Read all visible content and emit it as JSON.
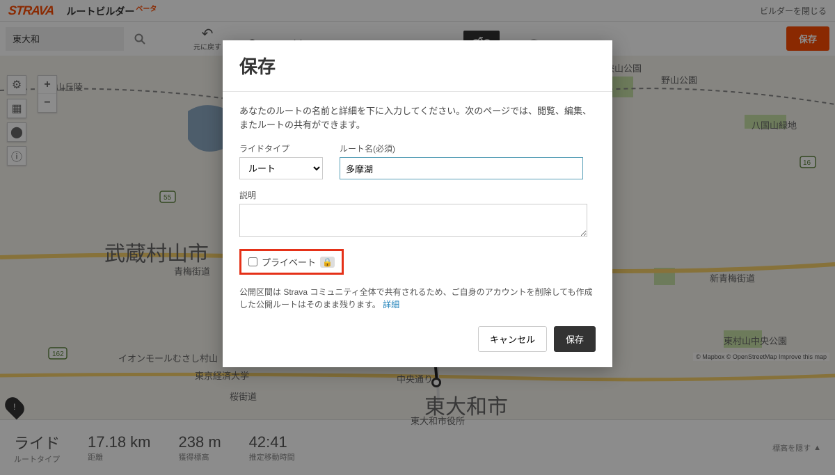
{
  "header": {
    "logo": "STRAVA",
    "title": "ルートビルダー",
    "beta": "ベータ",
    "close": "ビルダーを閉じる"
  },
  "toolbar": {
    "search_value": "東大和",
    "undo": "元に戻す",
    "save_label": "保存"
  },
  "modal": {
    "title": "保存",
    "description": "あなたのルートの名前と詳細を下に入力してください。次のページでは、閲覧、編集、またルートの共有ができます。",
    "ride_type_label": "ライドタイプ",
    "ride_type_value": "ルート",
    "route_name_label": "ルート名(必須)",
    "route_name_value": "多摩湖",
    "desc_label": "説明",
    "desc_value": "",
    "private_label": "プライベート",
    "note_text": "公開区間は Strava コミュニティ全体で共有されるため、ご自身のアカウントを削除しても作成した公開ルートはそのまま残ります。",
    "note_link": "詳細",
    "cancel": "キャンセル",
    "save": "保存"
  },
  "stats": {
    "s1_v": "ライド",
    "s1_l": "ルートタイプ",
    "s2_v": "17.18 km",
    "s2_l": "距離",
    "s3_v": "238 m",
    "s3_l": "獲得標高",
    "s4_v": "42:41",
    "s4_l": "推定移動時間",
    "elev_toggle": "標高を隠す"
  },
  "map": {
    "label1": "武蔵村山市",
    "label2": "東大和市",
    "road1": "新青梅街道",
    "road2": "青梅街道",
    "road3": "中央通り",
    "road4": "桜街道",
    "park1": "狭山公園",
    "park2": "八国山緑地",
    "park3": "野山公園",
    "park4": "東村山中央公園",
    "spot1": "山丘陵",
    "spot2": "イオンモールむさし村山",
    "spot3": "東京経済大学",
    "spot4": "東大和市役所",
    "attribution": "© Mapbox © OpenStreetMap Improve this map"
  }
}
